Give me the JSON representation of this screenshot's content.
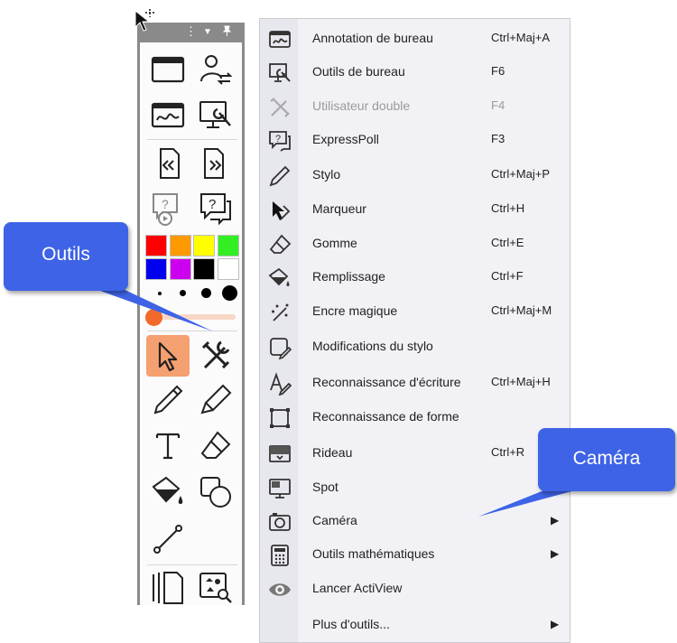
{
  "toolbar": {
    "header_icons": [
      "more-vertical-icon",
      "chevron-down-icon",
      "pin-icon"
    ],
    "colors": [
      "#ff0000",
      "#ff9900",
      "#ffff00",
      "#33ee22",
      "#0000ee",
      "#cc00ee",
      "#000000",
      "#ffffff"
    ],
    "selected_tool": "select-arrow",
    "active_pen_color": "#f26a2a"
  },
  "menu": {
    "items": [
      {
        "label": "Annotation de bureau",
        "shortcut": "Ctrl+Maj+A",
        "icon": "desktop-annotation-icon"
      },
      {
        "label": "Outils de bureau",
        "shortcut": "F6",
        "icon": "desktop-tools-icon"
      },
      {
        "label": "Utilisateur double",
        "shortcut": "F4",
        "icon": "dual-user-icon",
        "disabled": true
      },
      {
        "label": "ExpressPoll",
        "shortcut": "F3",
        "icon": "expresspoll-icon"
      },
      {
        "label": "Stylo",
        "shortcut": "Ctrl+Maj+P",
        "icon": "pen-icon"
      },
      {
        "label": "Marqueur",
        "shortcut": "Ctrl+H",
        "icon": "marker-icon"
      },
      {
        "label": "Gomme",
        "shortcut": "Ctrl+E",
        "icon": "eraser-icon"
      },
      {
        "label": "Remplissage",
        "shortcut": "Ctrl+F",
        "icon": "fill-bucket-icon"
      },
      {
        "label": "Encre magique",
        "shortcut": "Ctrl+Maj+M",
        "icon": "magic-ink-icon"
      },
      {
        "label": "Modifications du stylo",
        "shortcut": "",
        "icon": "pen-modifications-icon"
      },
      {
        "label": "Reconnaissance d'écriture",
        "shortcut": "Ctrl+Maj+H",
        "icon": "handwriting-recognition-icon"
      },
      {
        "label": "Reconnaissance de forme",
        "shortcut": "",
        "icon": "shape-recognition-icon"
      },
      {
        "label": "Rideau",
        "shortcut": "Ctrl+R",
        "icon": "curtain-icon"
      },
      {
        "label": "Spot",
        "shortcut": "",
        "icon": "spotlight-icon"
      },
      {
        "label": "Caméra",
        "shortcut": "",
        "icon": "camera-icon",
        "submenu": true
      },
      {
        "label": "Outils mathématiques",
        "shortcut": "",
        "icon": "calculator-icon",
        "submenu": true
      },
      {
        "label": "Lancer ActiView",
        "shortcut": "",
        "icon": "eye-icon"
      },
      {
        "label": "Plus d'outils...",
        "shortcut": "",
        "icon": "more-tools-icon",
        "submenu": true
      }
    ],
    "submenu_arrow": "▶"
  },
  "callouts": {
    "outils": "Outils",
    "camera": "Caméra"
  }
}
